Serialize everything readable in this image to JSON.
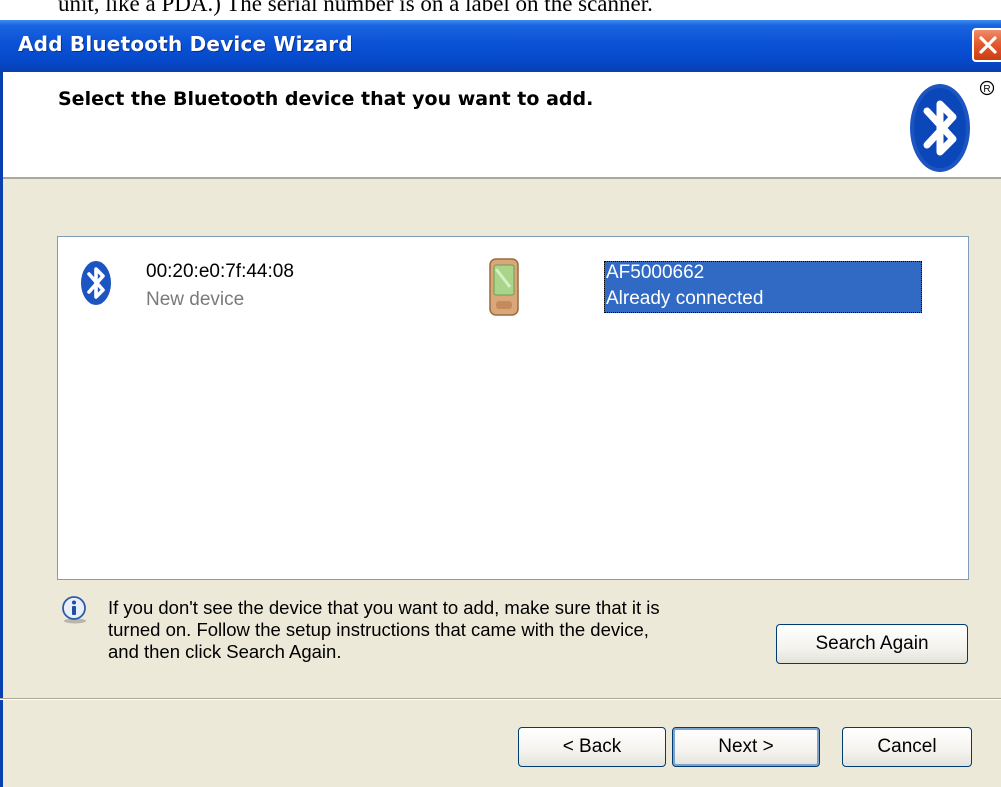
{
  "document": {
    "overflow_text": "unit, like a PDA.) The serial number is on a label on the scanner."
  },
  "window": {
    "title": "Add Bluetooth Device Wizard",
    "close_icon": "close-icon"
  },
  "header": {
    "title": "Select the Bluetooth device that you want to add.",
    "logo_icon": "bluetooth-logo-icon"
  },
  "device_list": {
    "items": [
      {
        "name": "00:20:e0:7f:44:08",
        "status": "New device",
        "icon": "bluetooth-device-icon",
        "selected": false
      },
      {
        "name": "AF5000662",
        "status": "Already connected",
        "icon": "pda-icon",
        "selected": true
      }
    ]
  },
  "info": {
    "icon": "info-icon",
    "lines": [
      "If you don't see the device that you want to add, make sure that it is",
      "turned on. Follow the setup instructions that came with the device,",
      "and then click Search Again."
    ]
  },
  "buttons": {
    "search_again": "Search Again",
    "back": "< Back",
    "next": "Next >",
    "cancel": "Cancel"
  },
  "colors": {
    "titlebar": "#0a52d6",
    "selection": "#316ac5",
    "dialog_bg": "#ece9d8"
  }
}
